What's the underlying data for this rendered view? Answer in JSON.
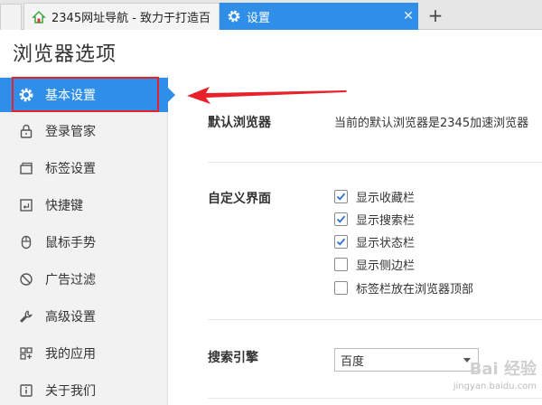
{
  "tabs": [
    {
      "title": "2345网址导航 - 致力于打造百",
      "icon": "house-icon",
      "active": false
    },
    {
      "title": "设置",
      "icon": "gear-icon",
      "active": true,
      "close": "✕"
    }
  ],
  "new_tab_label": "+",
  "page_title": "浏览器选项",
  "sidebar": {
    "items": [
      {
        "label": "基本设置",
        "icon": "gear-icon"
      },
      {
        "label": "登录管家",
        "icon": "lock-icon"
      },
      {
        "label": "标签设置",
        "icon": "tabs-icon"
      },
      {
        "label": "快捷键",
        "icon": "keyboard-icon"
      },
      {
        "label": "鼠标手势",
        "icon": "mouse-icon"
      },
      {
        "label": "广告过滤",
        "icon": "block-icon"
      },
      {
        "label": "高级设置",
        "icon": "wrench-icon"
      },
      {
        "label": "我的应用",
        "icon": "apps-icon"
      },
      {
        "label": "关于我们",
        "icon": "info-icon"
      }
    ]
  },
  "default_browser": {
    "label": "默认浏览器",
    "value": "当前的默认浏览器是2345加速浏览器"
  },
  "custom_ui": {
    "label": "自定义界面",
    "options": [
      {
        "label": "显示收藏栏",
        "checked": true
      },
      {
        "label": "显示搜索栏",
        "checked": true
      },
      {
        "label": "显示状态栏",
        "checked": true
      },
      {
        "label": "显示侧边栏",
        "checked": false
      },
      {
        "label": "标签栏放在浏览器顶部",
        "checked": false
      }
    ]
  },
  "search_engine": {
    "label": "搜索引擎",
    "selected": "百度"
  },
  "watermark": {
    "main": "Bai 经验",
    "sub": "jingyan.baidu.com"
  },
  "colors": {
    "accent": "#2f8fe8",
    "annotation": "#e8212b",
    "sidebar_bg": "#f2f2f2"
  }
}
